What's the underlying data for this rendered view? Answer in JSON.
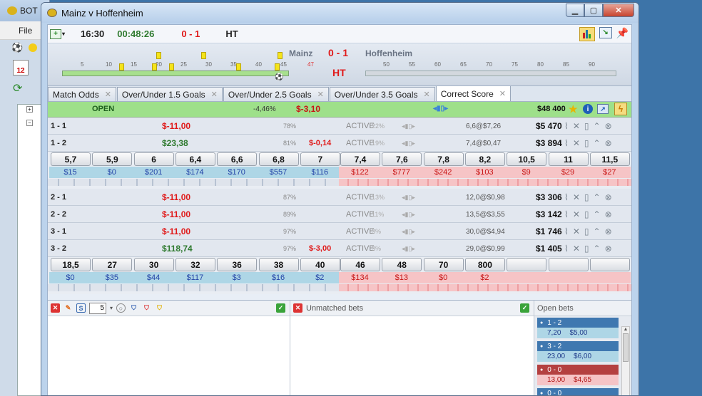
{
  "bg_window": {
    "title": "BOT",
    "menu": "File"
  },
  "window": {
    "title": "Mainz v Hoffenheim"
  },
  "toolbar": {
    "clock": "16:30",
    "elapsed": "00:48:26",
    "score": "0 - 1",
    "status": "HT"
  },
  "scoreboard": {
    "home": "Mainz",
    "score": "0 - 1",
    "away": "Hoffenheim",
    "period": "HT",
    "home_ticks": [
      "5",
      "10",
      "15",
      "20",
      "25",
      "30",
      "35",
      "40",
      "45"
    ],
    "home_extra": "47",
    "away_ticks": [
      "50",
      "55",
      "60",
      "65",
      "70",
      "75",
      "80",
      "85",
      "90"
    ]
  },
  "tabs": [
    "Match Odds",
    "Over/Under 1.5 Goals",
    "Over/Under 2.5 Goals",
    "Over/Under 3.5 Goals",
    "Correct Score"
  ],
  "open": {
    "status": "OPEN",
    "pct": "-4,46%",
    "pl": "$-3,10",
    "matched": "$48 400"
  },
  "runners_a": [
    {
      "name": "1 - 1",
      "pl": "$-11,00",
      "pl_color": "red",
      "pct": "78%",
      "red": "",
      "status": "ACTIVE",
      "prob": "22%",
      "pair": "6,6@$7,26",
      "liq": "$5 470"
    },
    {
      "name": "1 - 2",
      "pl": "$23,38",
      "pl_color": "green",
      "pct": "81%",
      "red": "$-0,14",
      "status": "ACTIVE",
      "prob": "19%",
      "pair": "7,4@$0,47",
      "liq": "$3 894"
    }
  ],
  "ladder_a": {
    "back_odds": [
      "5,7",
      "5,9",
      "6",
      "6,4",
      "6,6",
      "6,8",
      "7"
    ],
    "back_vol": [
      "$15",
      "$0",
      "$201",
      "$174",
      "$170",
      "$557",
      "$116"
    ],
    "lay_odds": [
      "7,4",
      "7,6",
      "7,8",
      "8,2",
      "10,5",
      "11",
      "11,5"
    ],
    "lay_vol": [
      "$122",
      "$777",
      "$242",
      "$103",
      "$9",
      "$29",
      "$27"
    ]
  },
  "runners_b": [
    {
      "name": "2 - 1",
      "pl": "$-11,00",
      "pl_color": "red",
      "pct": "87%",
      "red": "",
      "status": "ACTIVE",
      "prob": "13%",
      "pair": "12,0@$0,98",
      "liq": "$3 306"
    },
    {
      "name": "2 - 2",
      "pl": "$-11,00",
      "pl_color": "red",
      "pct": "89%",
      "red": "",
      "status": "ACTIVE",
      "prob": "11%",
      "pair": "13,5@$3,55",
      "liq": "$3 142"
    },
    {
      "name": "3 - 1",
      "pl": "$-11,00",
      "pl_color": "red",
      "pct": "97%",
      "red": "",
      "status": "ACTIVE",
      "prob": "3%",
      "pair": "30,0@$4,94",
      "liq": "$1 746"
    },
    {
      "name": "3 - 2",
      "pl": "$118,74",
      "pl_color": "green",
      "pct": "97%",
      "red": "$-3,00",
      "status": "ACTIVE",
      "prob": "3%",
      "pair": "29,0@$0,99",
      "liq": "$1 405"
    }
  ],
  "ladder_b": {
    "back_odds": [
      "18,5",
      "27",
      "30",
      "32",
      "36",
      "38",
      "40"
    ],
    "back_vol": [
      "$0",
      "$35",
      "$44",
      "$117",
      "$3",
      "$16",
      "$2"
    ],
    "lay_odds": [
      "46",
      "48",
      "70",
      "800",
      "",
      "",
      ""
    ],
    "lay_vol": [
      "$134",
      "$13",
      "$0",
      "$2",
      "",
      "",
      ""
    ]
  },
  "bottom": {
    "stake": "5",
    "unmatched_title": "Unmatched bets",
    "open_title": "Open bets",
    "open_bets": [
      {
        "side": "back",
        "sel": "1 - 2",
        "odds": "7,20",
        "stake": "$5,00"
      },
      {
        "side": "back",
        "sel": "3 - 2",
        "odds": "23,00",
        "stake": "$6,00"
      },
      {
        "side": "lay",
        "sel": "0 - 0",
        "odds": "13,00",
        "stake": "$4,65"
      },
      {
        "side": "back",
        "sel": "0 - 0",
        "odds": "",
        "stake": ""
      }
    ]
  },
  "colors": {
    "back": "#aed6e6",
    "lay": "#f6c4c6",
    "open": "#9ee08a",
    "profit": "#2f7a2f",
    "loss": "#e01a1a"
  }
}
